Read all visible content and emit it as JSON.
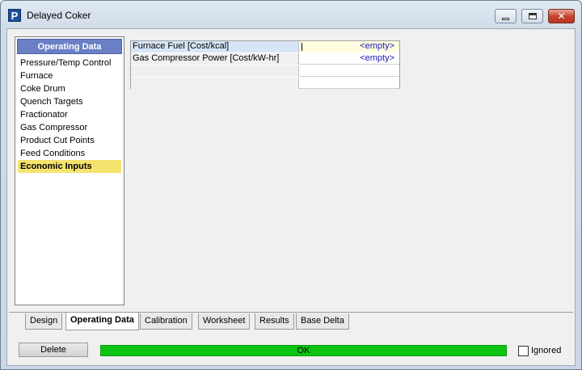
{
  "window": {
    "title": "Delayed Coker",
    "app_icon_letter": "P",
    "controls": {
      "close_glyph": "✕"
    }
  },
  "nav": {
    "header": "Operating Data",
    "items": [
      {
        "label": "Pressure/Temp Control",
        "selected": false
      },
      {
        "label": "Furnace",
        "selected": false
      },
      {
        "label": "Coke Drum",
        "selected": false
      },
      {
        "label": "Quench Targets",
        "selected": false
      },
      {
        "label": "Fractionator",
        "selected": false
      },
      {
        "label": "Gas Compressor",
        "selected": false
      },
      {
        "label": "Product Cut Points",
        "selected": false
      },
      {
        "label": "Feed Conditions",
        "selected": false
      },
      {
        "label": "Economic Inputs",
        "selected": true
      }
    ]
  },
  "grid": {
    "rows": [
      {
        "label": "Furnace Fuel [Cost/kcal]",
        "value": "<empty>"
      },
      {
        "label": "Gas Compressor Power [Cost/kW-hr]",
        "value": "<empty>"
      },
      {
        "label": "",
        "value": ""
      },
      {
        "label": "",
        "value": ""
      }
    ]
  },
  "tabs": [
    {
      "label": "Design",
      "active": false
    },
    {
      "label": "Operating Data",
      "active": true
    },
    {
      "label": "Calibration",
      "active": false
    },
    {
      "label": "Worksheet",
      "active": false
    },
    {
      "label": "Results",
      "active": false
    },
    {
      "label": "Base Delta",
      "active": false
    }
  ],
  "footer": {
    "delete_label": "Delete",
    "status_text": "OK",
    "status_color": "#0dc312",
    "ignored_label": "Ignored",
    "ignored_checked": false
  },
  "colors": {
    "nav_header_bg": "#6a7fc4",
    "selected_item_bg": "#f5e36f",
    "empty_value_text": "#1a1ab4"
  },
  "icons": {
    "app": "process-app-icon",
    "minimize": "minimize-icon",
    "maximize": "maximize-icon",
    "close": "close-icon"
  }
}
